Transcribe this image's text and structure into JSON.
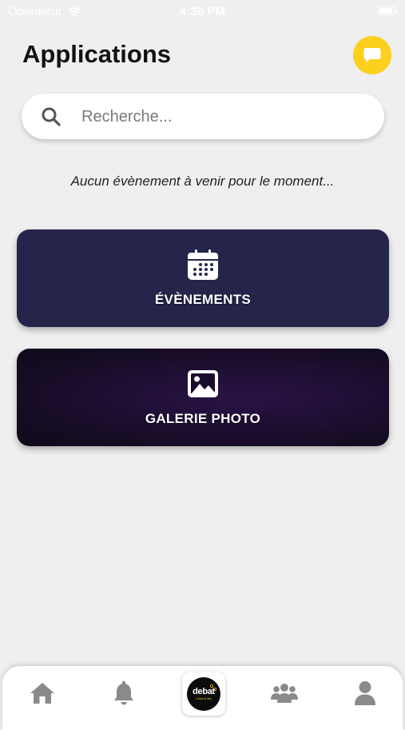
{
  "status": {
    "carrier": "Opérateur",
    "time": "4:30 PM"
  },
  "header": {
    "title": "Applications",
    "chat_icon": "chat-bubble-icon",
    "accent": "#fcd01c"
  },
  "search": {
    "placeholder": "Recherche...",
    "value": ""
  },
  "empty_message": "Aucun évènement à venir pour le moment...",
  "cards": [
    {
      "label": "ÉVÈNEMENTS",
      "icon": "calendar-icon",
      "color": "#25244a"
    },
    {
      "label": "GALERIE PHOTO",
      "icon": "image-icon",
      "color": "#1a0d2c"
    }
  ],
  "nav": {
    "items": [
      "home-icon",
      "bell-icon",
      "debat-logo",
      "group-icon",
      "user-icon"
    ],
    "logo_text": "debat",
    "logo_subtext": "Créez le lien"
  }
}
